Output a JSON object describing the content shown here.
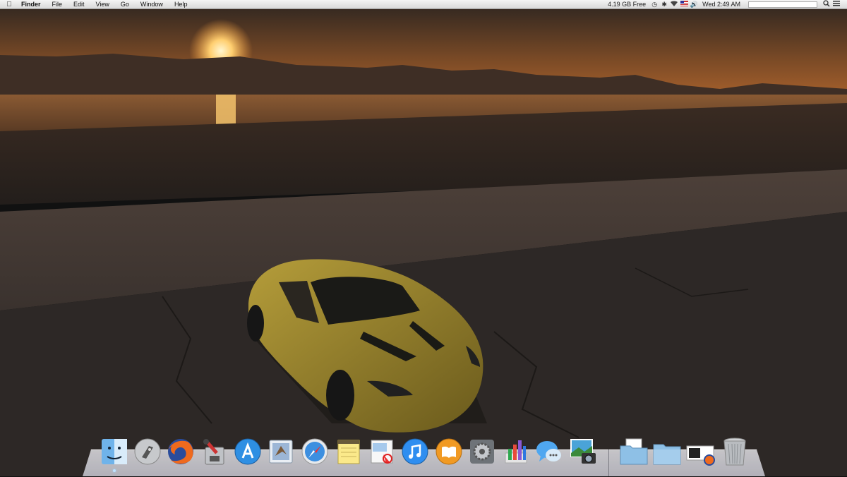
{
  "menubar": {
    "apple_glyph": "",
    "app_name": "Finder",
    "menus": [
      "File",
      "Edit",
      "View",
      "Go",
      "Window",
      "Help"
    ],
    "disk_free": "4.19 GB Free",
    "clock": "Wed 2:49 AM",
    "status_icons": [
      "time-machine-icon",
      "bluetooth-icon",
      "wifi-icon",
      "flag-icon",
      "volume-icon"
    ],
    "right_icons": [
      "spotlight-icon",
      "notification-center-icon"
    ]
  },
  "dock": {
    "apps": [
      {
        "name": "finder",
        "running": true
      },
      {
        "name": "launchpad",
        "running": false
      },
      {
        "name": "firefox",
        "running": false
      },
      {
        "name": "system-utility",
        "running": false
      },
      {
        "name": "app-store",
        "running": false
      },
      {
        "name": "mail",
        "running": false
      },
      {
        "name": "safari",
        "running": false
      },
      {
        "name": "notes",
        "running": false
      },
      {
        "name": "calendar",
        "running": false
      },
      {
        "name": "itunes",
        "running": false
      },
      {
        "name": "ibooks",
        "running": false
      },
      {
        "name": "system-preferences",
        "running": false
      },
      {
        "name": "numbers",
        "running": false
      },
      {
        "name": "messages",
        "running": false
      },
      {
        "name": "iphoto",
        "running": false
      }
    ],
    "stacks": [
      "documents-folder",
      "downloads-folder",
      "firefox-download",
      "trash"
    ]
  },
  "colors": {
    "sky": "#3a2a20",
    "sun": "#ffd88a",
    "road": "#2e2a27",
    "car": "#8a7a2a"
  }
}
